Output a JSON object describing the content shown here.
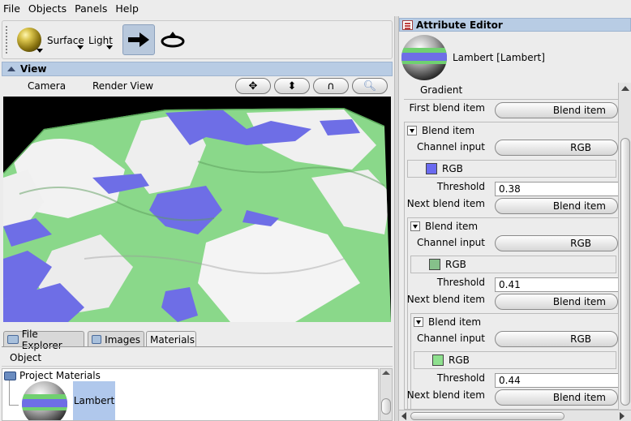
{
  "menu": [
    "File",
    "Objects",
    "Panels",
    "Help"
  ],
  "toolbar": {
    "surface_label": "Surface",
    "light_label": "Light"
  },
  "view": {
    "title": "View",
    "camera_label": "Camera",
    "render_view_label": "Render View"
  },
  "tabs": [
    "File Explorer",
    "Images",
    "Materials"
  ],
  "object_label": "Object",
  "project_materials_label": "Project Materials",
  "lambert_item_label": "Lambert",
  "attribute_editor": {
    "title": "Attribute Editor",
    "material_name": "Lambert [Lambert]",
    "gradient_label": "Gradient",
    "first_blend_item_label": "First blend item",
    "first_blend_item_value": "Blend item",
    "blend_items": [
      {
        "label": "Blend item",
        "channel_input_label": "Channel input",
        "channel_input_value": "RGB",
        "rgb_label": "RGB",
        "swatch_color": "#6a6af0",
        "threshold_label": "Threshold",
        "threshold": "0.38",
        "next_label": "Next blend item",
        "next_value": "Blend item"
      },
      {
        "label": "Blend item",
        "channel_input_label": "Channel input",
        "channel_input_value": "RGB",
        "rgb_label": "RGB",
        "swatch_color": "#86c08a",
        "threshold_label": "Threshold",
        "threshold": "0.41",
        "next_label": "Next blend item",
        "next_value": "Blend item"
      },
      {
        "label": "Blend item",
        "channel_input_label": "Channel input",
        "channel_input_value": "RGB",
        "rgb_label": "RGB",
        "swatch_color": "#8ee08e",
        "threshold_label": "Threshold",
        "threshold": "0.44",
        "next_label": "Next blend item",
        "next_value": "Blend item"
      }
    ]
  },
  "colors": {
    "title_bar": "#b8cce4",
    "selection": "#b0c8ec",
    "water": "#6e6ee6",
    "grass": "#7ad47a",
    "snow": "#f0f0f0"
  }
}
